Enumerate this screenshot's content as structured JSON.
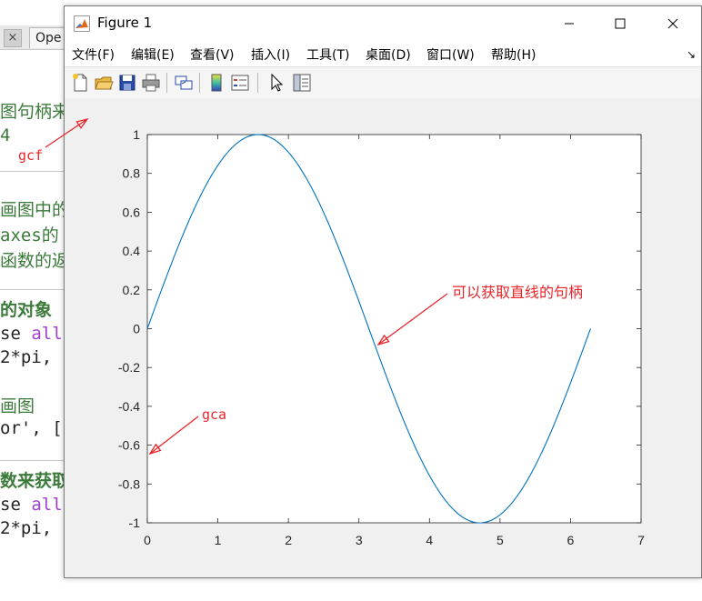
{
  "background_editor": {
    "tab_close_glyph": "×",
    "tab_label": "Ope",
    "lines": [
      {
        "text": "图句柄来",
        "style": "green"
      },
      {
        "text": "4",
        "style": "green"
      },
      {
        "text": "画图中的",
        "style": "green"
      },
      {
        "text": "axes的",
        "style": "green"
      },
      {
        "text": "函数的返",
        "style": "green"
      },
      {
        "text": "的对象",
        "style": "bold"
      },
      {
        "text": "se all",
        "style": "code-kw"
      },
      {
        "text": " 2*pi,",
        "style": "code"
      },
      {
        "text": "画图",
        "style": "green"
      },
      {
        "text": "or', [",
        "style": "code"
      },
      {
        "text": "数来获取",
        "style": "bold"
      },
      {
        "text": "se all",
        "style": "code-kw"
      },
      {
        "text": " 2*pi,",
        "style": "code"
      }
    ]
  },
  "window": {
    "title": "Figure 1",
    "minimize_icon": "minimize-icon",
    "maximize_icon": "maximize-icon",
    "close_icon": "close-icon"
  },
  "menu": {
    "items": [
      "文件(F)",
      "编辑(E)",
      "查看(V)",
      "插入(I)",
      "工具(T)",
      "桌面(D)",
      "窗口(W)",
      "帮助(H)"
    ],
    "dock_glyph": "↘"
  },
  "toolbar": {
    "buttons": [
      "new-figure-icon",
      "open-file-icon",
      "save-icon",
      "print-icon",
      "link-plot-icon",
      "colorbar-icon",
      "legend-icon",
      "pointer-icon",
      "property-inspector-icon"
    ]
  },
  "annotations": {
    "gcf": "gcf",
    "gca": "gca",
    "line_handle": "可以获取直线的句柄"
  },
  "chart_data": {
    "type": "line",
    "title": "",
    "xlabel": "",
    "ylabel": "",
    "xlim": [
      0,
      7
    ],
    "ylim": [
      -1,
      1
    ],
    "xticks": [
      0,
      1,
      2,
      3,
      4,
      5,
      6,
      7
    ],
    "yticks": [
      -1,
      -0.8,
      -0.6,
      -0.4,
      -0.2,
      0,
      0.2,
      0.4,
      0.6,
      0.8,
      1
    ],
    "ytick_labels": [
      "-1",
      "-0.8",
      "-0.6",
      "-0.4",
      "-0.2",
      "0",
      "0.2",
      "0.4",
      "0.6",
      "0.8",
      "1"
    ],
    "grid": false,
    "series": [
      {
        "function": "sin(x)",
        "x": [
          0,
          0.3927,
          0.7854,
          1.1781,
          1.5708,
          1.9635,
          2.3562,
          2.7489,
          3.1416,
          3.5343,
          3.927,
          4.3197,
          4.7124,
          5.1051,
          5.4978,
          5.8905,
          6.2832
        ],
        "y": [
          0,
          0.3827,
          0.7071,
          0.9239,
          1,
          0.9239,
          0.7071,
          0.3827,
          0,
          -0.3827,
          -0.7071,
          -0.9239,
          -1,
          -0.9239,
          -0.7071,
          -0.3827,
          0
        ],
        "color": "#0072bd"
      }
    ],
    "annotation_color": "#e8252a"
  }
}
